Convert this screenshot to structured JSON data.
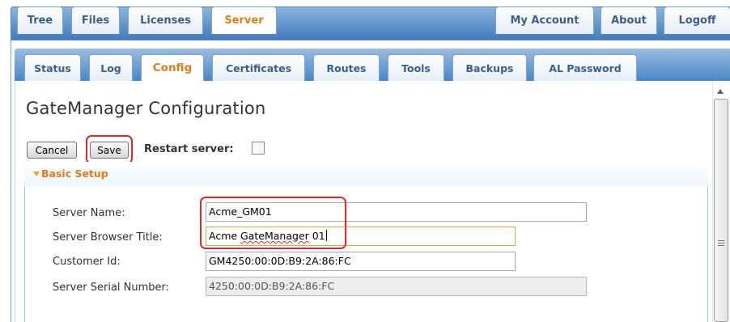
{
  "top_nav": {
    "tabs": [
      {
        "label": "Tree",
        "active": false
      },
      {
        "label": "Files",
        "active": false
      },
      {
        "label": "Licenses",
        "active": false
      },
      {
        "label": "Server",
        "active": true
      }
    ],
    "right_tabs": [
      {
        "label": "My Account"
      },
      {
        "label": "About"
      },
      {
        "label": "Logoff"
      }
    ]
  },
  "sub_nav": {
    "tabs": [
      {
        "label": "Status",
        "active": false
      },
      {
        "label": "Log",
        "active": false
      },
      {
        "label": "Config",
        "active": true
      },
      {
        "label": "Certificates",
        "active": false
      },
      {
        "label": "Routes",
        "active": false
      },
      {
        "label": "Tools",
        "active": false
      },
      {
        "label": "Backups",
        "active": false
      },
      {
        "label": "AL Password",
        "active": false
      }
    ]
  },
  "page": {
    "title": "GateManager Configuration"
  },
  "actions": {
    "cancel_label": "Cancel",
    "save_label": "Save",
    "restart_label": "Restart server:",
    "restart_checked": false
  },
  "basic_setup": {
    "title": "Basic Setup",
    "fields": [
      {
        "label": "Server Name:",
        "value": "Acme_GM01"
      },
      {
        "label": "Server Browser Title:",
        "value_prefix": "Acme ",
        "value_misspelled": "GateManager",
        "value_suffix": " 01"
      },
      {
        "label": "Customer Id:",
        "value": "GM4250:00:0D:B9:2A:86:FC"
      },
      {
        "label": "Server Serial Number:",
        "value": "4250:00:0D:B9:2A:86:FC"
      }
    ]
  },
  "colors": {
    "active_tab_text": "#e27b1c",
    "tab_text": "#3b5f8a",
    "nav_bar": "#4a86c6",
    "highlight": "#e3262b"
  }
}
